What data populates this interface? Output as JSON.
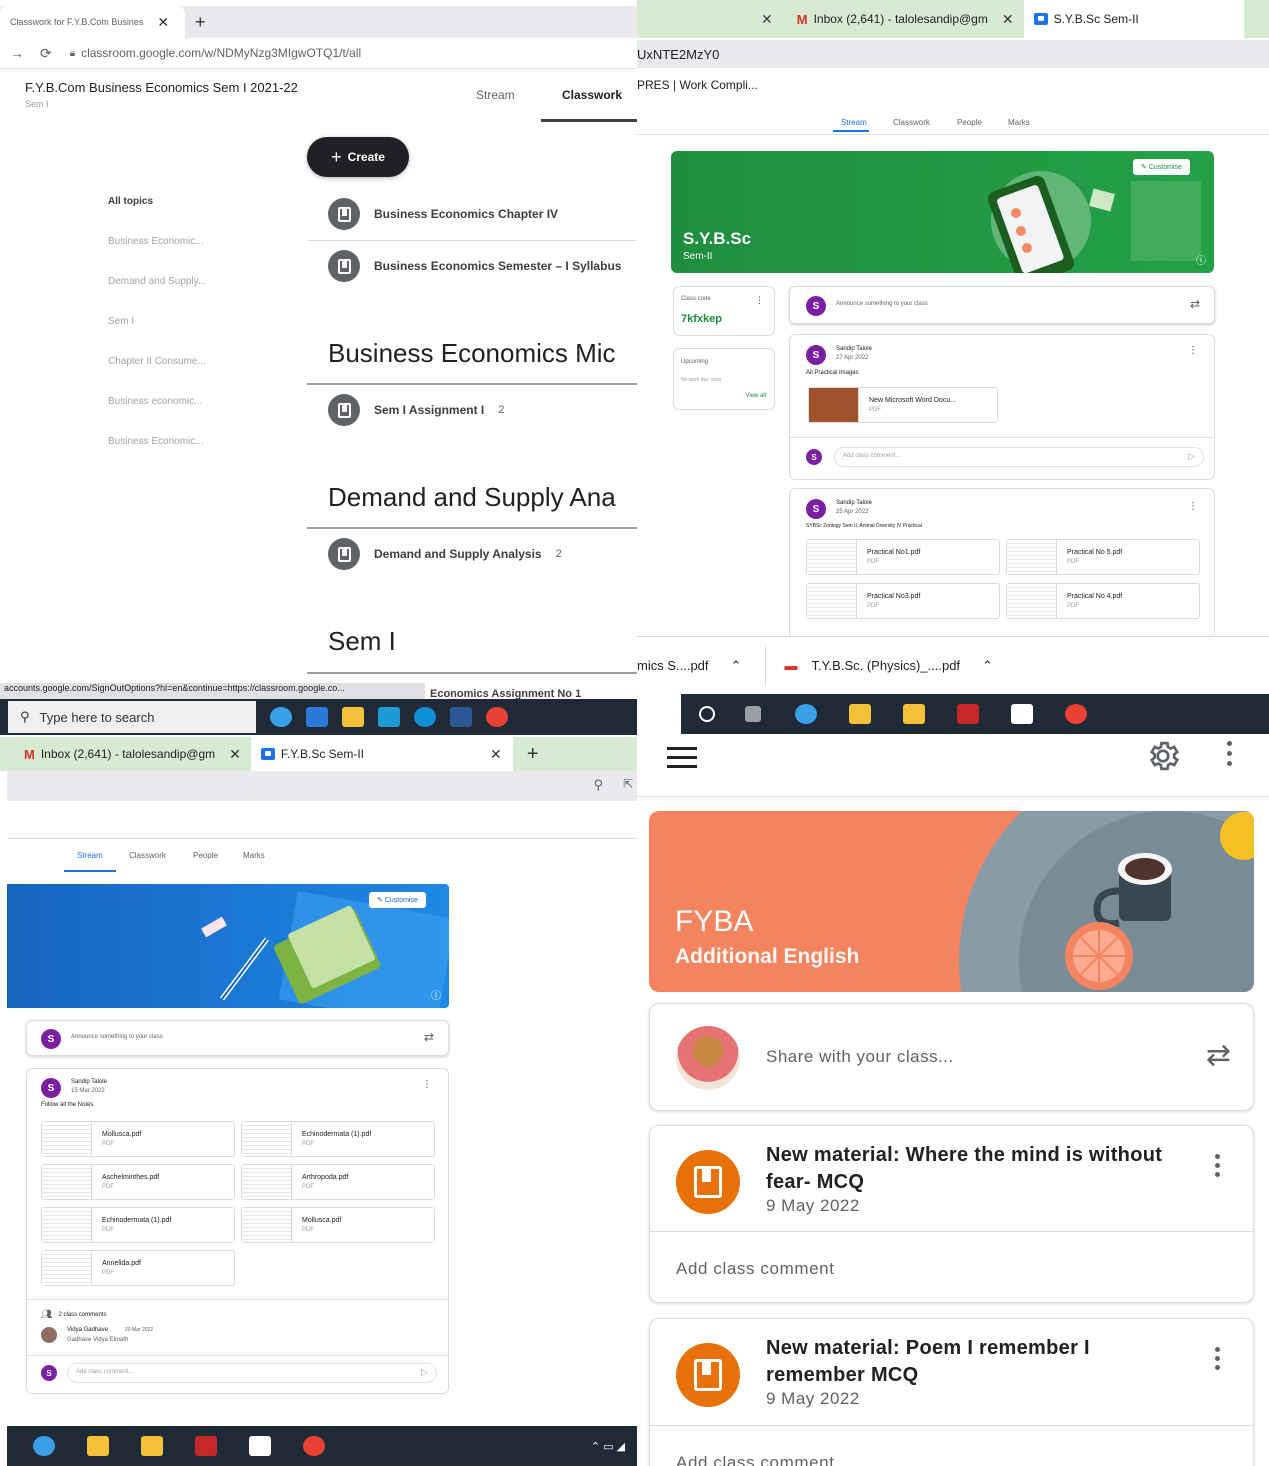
{
  "q1": {
    "tab_title": "Classwork for F.Y.B.Com Busines",
    "url": "classroom.google.com/w/NDMyNzg3MIgwOTQ1/t/all",
    "class_title": "F.Y.B.Com Business Economics Sem I 2021-22",
    "class_section": "Sem I",
    "nav": [
      "Stream",
      "Classwork"
    ],
    "create_label": "Create",
    "topics": [
      "All topics",
      "Business Economic...",
      "Demand and Supply...",
      "Sem I",
      "Chapter II Consume...",
      "Business economic...",
      "Business Economic..."
    ],
    "materials": [
      {
        "title": "Business Economics Chapter IV",
        "count": ""
      },
      {
        "title": "Business Economics Semester – I Syllabus",
        "count": ""
      }
    ],
    "topic_heads": [
      "Business Economics Mic",
      "Demand and Supply Ana",
      "Sem I"
    ],
    "assignment": {
      "title": "Sem I Assignment I",
      "count": "2"
    },
    "demand_item": {
      "title": "Demand and Supply Analysis",
      "count": "2"
    },
    "status_url": "accounts.google.com/SignOutOptions?hl=en&continue=https://classroom.google.co...",
    "partial_row": "Economics Assignment No 1",
    "search_placeholder": "Type here to search"
  },
  "q2": {
    "tab_gmail": "Inbox (2,641) - talolesandip@gm",
    "tab_class": "S.Y.B.Sc Sem-II",
    "addr_fragment": "UxNTE2MzY0",
    "bookmark": "PRES | Work Compli...",
    "nav": [
      "Stream",
      "Classwork",
      "People",
      "Marks"
    ],
    "banner_title": "S.Y.B.Sc",
    "banner_section": "Sem-II",
    "customise": "Customise",
    "class_code_label": "Class code",
    "class_code": "7kfxkep",
    "upcoming_label": "Upcoming",
    "upcoming_text": "No work due soon",
    "view_all": "View all",
    "announce_placeholder": "Announce something to your class",
    "post1": {
      "author": "Sandip Talole",
      "date": "27 Apr 2022",
      "text": "All Practical Images",
      "file": "New Microsoft Word Docu...",
      "type": "PDF"
    },
    "comment_placeholder": "Add class comment...",
    "post2": {
      "author": "Sandip Talole",
      "date": "25 Apr 2022",
      "text": "SYBSc Zoology Sem II, Animal Diversity IV Practical",
      "files": [
        {
          "name": "Practical No1.pdf",
          "type": "PDF"
        },
        {
          "name": "Practical No 5.pdf",
          "type": "PDF"
        },
        {
          "name": "Practical No3.pdf",
          "type": "PDF"
        },
        {
          "name": "Practical No 4.pdf",
          "type": "PDF"
        }
      ]
    },
    "downloads": [
      "mics S....pdf",
      "T.Y.B.Sc. (Physics)_....pdf"
    ]
  },
  "q3": {
    "tab_gmail": "Inbox (2,641) - talolesandip@gm",
    "tab_class": "F.Y.B.Sc Sem-II",
    "nav": [
      "Stream",
      "Classwork",
      "People",
      "Marks"
    ],
    "customise": "Customise",
    "announce_placeholder": "Announce something to your class",
    "post": {
      "author": "Sandip Talole",
      "date": "15 Mar 2022",
      "text": "Follow all the Notes",
      "files": [
        {
          "name": "Mollusca.pdf",
          "type": "PDF"
        },
        {
          "name": "Echinodermata (1).pdf",
          "type": "PDF"
        },
        {
          "name": "Aschelminthes.pdf",
          "type": "PDF"
        },
        {
          "name": "Arthropoda.pdf",
          "type": "PDF"
        },
        {
          "name": "Echinodermata (1).pdf",
          "type": "PDF"
        },
        {
          "name": "Mollusca.pdf",
          "type": "PDF"
        },
        {
          "name": "Annelida.pdf",
          "type": "PDF"
        }
      ]
    },
    "comments_count": "2 class comments",
    "commenter": {
      "name": "Vidya Gadhave",
      "date": "20 Mar 2022",
      "text": "Gadhave Vidya Eknath"
    },
    "comment_placeholder": "Add class comment..."
  },
  "q4": {
    "banner_title": "FYBA",
    "banner_subtitle": "Additional English",
    "share_placeholder": "Share with your class...",
    "posts": [
      {
        "title": "New material: Where the mind is without fear- MCQ",
        "date": "9 May 2022",
        "comment": "Add class comment"
      },
      {
        "title": "New material: Poem I remember I remember MCQ",
        "date": "9 May 2022",
        "comment": "Add class comment"
      }
    ]
  },
  "colors": {
    "classroom_green": "#1e8e3e",
    "classroom_blue": "#1e88e5",
    "fyba_orange": "#f4845f",
    "material_orange": "#e8710a",
    "avatar_purple": "#7b1fa2"
  }
}
